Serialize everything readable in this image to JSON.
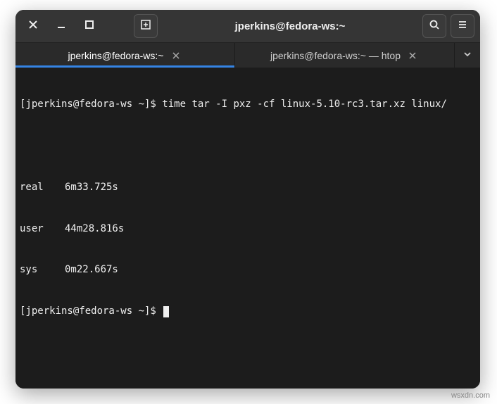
{
  "titlebar": {
    "title": "jperkins@fedora-ws:~"
  },
  "tabs": [
    {
      "label": "jperkins@fedora-ws:~",
      "active": true
    },
    {
      "label": "jperkins@fedora-ws:~ — htop",
      "active": false
    }
  ],
  "terminal": {
    "prompt1": "[jperkins@fedora-ws ~]$ ",
    "command": "time tar -I pxz -cf linux-5.10-rc3.tar.xz linux/",
    "timing": [
      {
        "label": "real",
        "value": "6m33.725s"
      },
      {
        "label": "user",
        "value": "44m28.816s"
      },
      {
        "label": "sys",
        "value": "0m22.667s"
      }
    ],
    "prompt2": "[jperkins@fedora-ws ~]$ "
  },
  "watermark": "wsxdn.com"
}
